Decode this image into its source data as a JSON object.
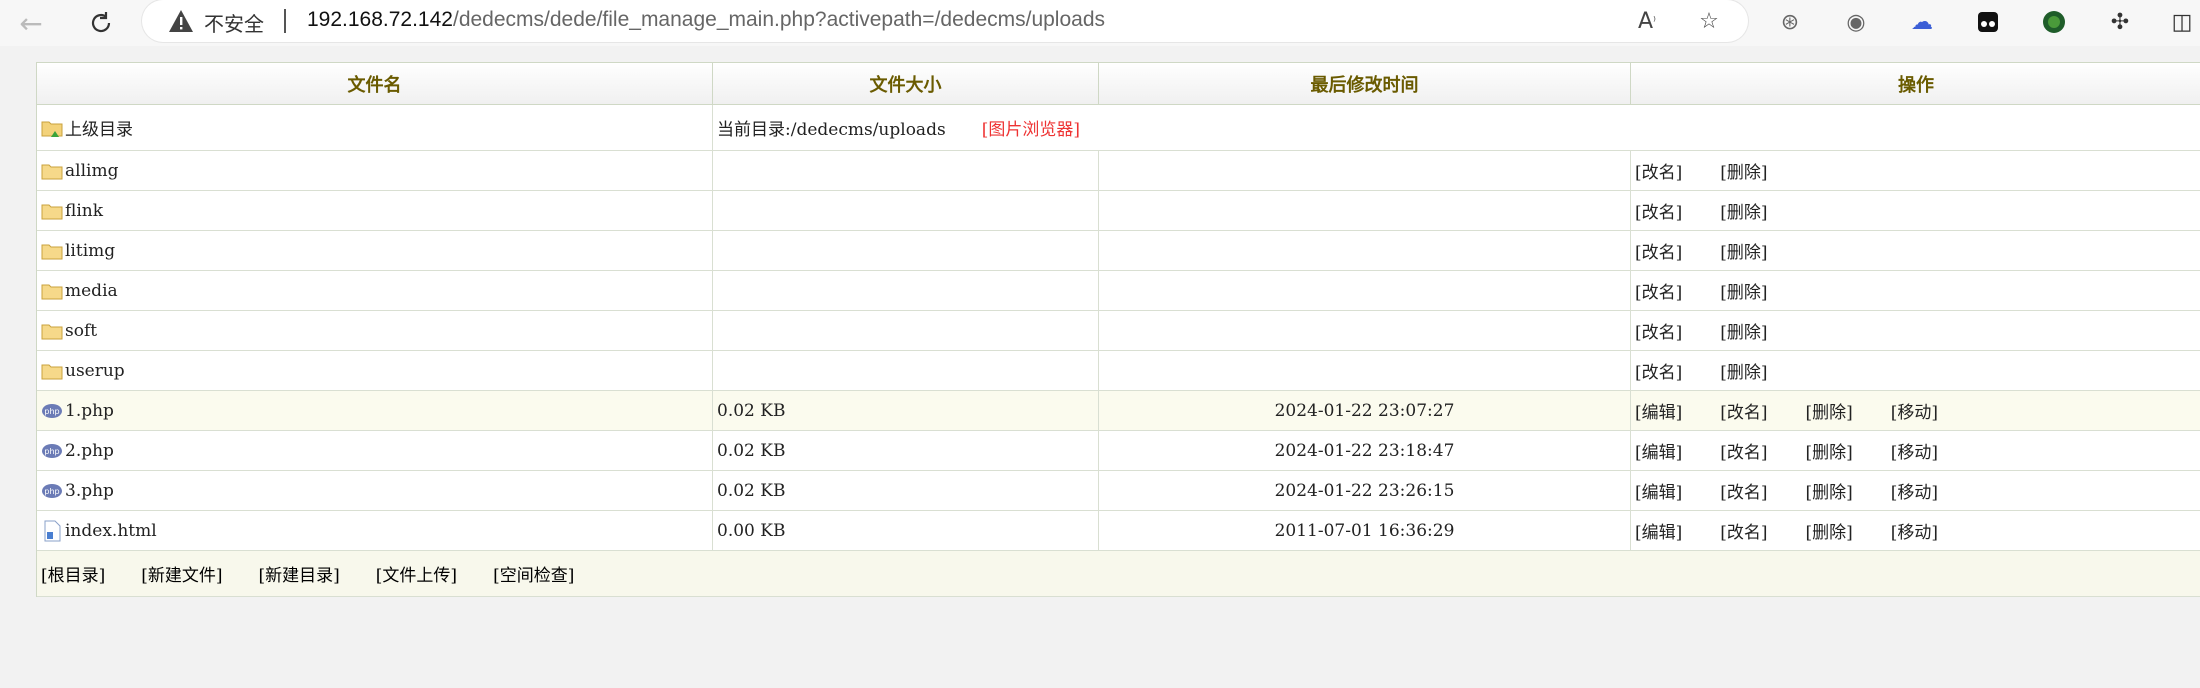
{
  "browser": {
    "insecure_label": "不安全",
    "url_host": "192.168.72.142",
    "url_path": "/dedecms/dede/file_manage_main.php?activepath=/dedecms/uploads"
  },
  "table": {
    "headers": [
      "文件名",
      "文件大小",
      "最后修改时间",
      "操作"
    ],
    "parent_row": {
      "name": "上级目录",
      "current_dir": "当前目录:/dedecms/uploads",
      "image_browser": "[图片浏览器]"
    },
    "folders": [
      {
        "name": "allimg",
        "rename": "[改名]",
        "delete": "[删除]"
      },
      {
        "name": "flink",
        "rename": "[改名]",
        "delete": "[删除]"
      },
      {
        "name": "litimg",
        "rename": "[改名]",
        "delete": "[删除]"
      },
      {
        "name": "media",
        "rename": "[改名]",
        "delete": "[删除]"
      },
      {
        "name": "soft",
        "rename": "[改名]",
        "delete": "[删除]"
      },
      {
        "name": "userup",
        "rename": "[改名]",
        "delete": "[删除]"
      }
    ],
    "files": [
      {
        "name": "1.php",
        "size": "0.02 KB",
        "mtime": "2024-01-22 23:07:27",
        "type": "php-file-icon"
      },
      {
        "name": "2.php",
        "size": "0.02 KB",
        "mtime": "2024-01-22 23:18:47",
        "type": "php-file-icon"
      },
      {
        "name": "3.php",
        "size": "0.02 KB",
        "mtime": "2024-01-22 23:26:15",
        "type": "php-file-icon"
      },
      {
        "name": "index.html",
        "size": "0.00 KB",
        "mtime": "2011-07-01 16:36:29",
        "type": "html-file-icon"
      }
    ],
    "file_actions": {
      "edit": "[编辑]",
      "rename": "[改名]",
      "delete": "[删除]",
      "move": "[移动]"
    },
    "footer": [
      "[根目录]",
      "[新建文件]",
      "[新建目录]",
      "[文件上传]",
      "[空间检查]"
    ]
  },
  "colors": {
    "header_text": "#6a5b00",
    "highlight_row": "#fbfbee",
    "link_red": "#ee3333",
    "border": "#cfd8c5"
  }
}
